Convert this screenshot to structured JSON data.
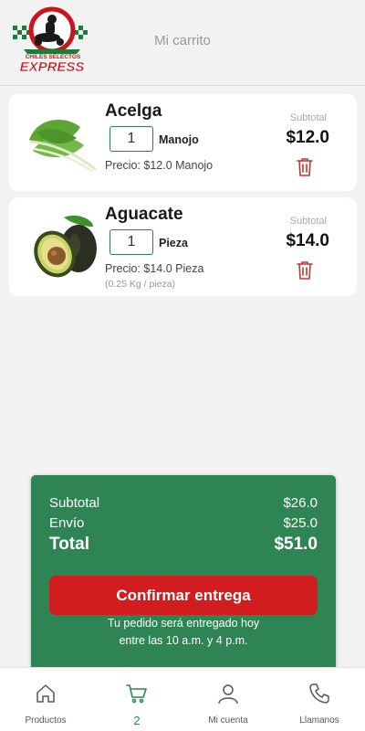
{
  "header": {
    "title": "Mi carrito",
    "logo_text_top": "CHILES SELECTOS",
    "logo_text_main": "EXPRESS"
  },
  "cart": {
    "items": [
      {
        "name": "Acelga",
        "quantity": "1",
        "unit": "Manojo",
        "price": "Precio: $12.0 Manojo",
        "subtotal_label": "Subtotal",
        "subtotal": "$12.0"
      },
      {
        "name": "Aguacate",
        "quantity": "1",
        "unit": "Pieza",
        "price": "Precio: $14.0 Pieza",
        "weight": "(0.25 Kg / pieza)",
        "subtotal_label": "Subtotal",
        "subtotal": "$14.0"
      }
    ]
  },
  "summary": {
    "subtotal_label": "Subtotal",
    "subtotal_value": "$26.0",
    "shipping_label": "Envío",
    "shipping_value": "$25.0",
    "total_label": "Total",
    "total_value": "$51.0",
    "confirm_label": "Confirmar entrega",
    "note_line1": "Tu pedido será entregado hoy",
    "note_line2": "entre las 10 a.m. y 4 p.m."
  },
  "nav": {
    "products_label": "Productos",
    "cart_count": "2",
    "account_label": "Mi cuenta",
    "call_label": "Llamanos"
  },
  "colors": {
    "brand_green": "#2e8553",
    "brand_red": "#d11d1d",
    "trash_red": "#c0392b"
  },
  "icons": [
    "logo-icon",
    "trash-icon",
    "home-icon",
    "cart-icon",
    "user-icon",
    "phone-icon"
  ]
}
